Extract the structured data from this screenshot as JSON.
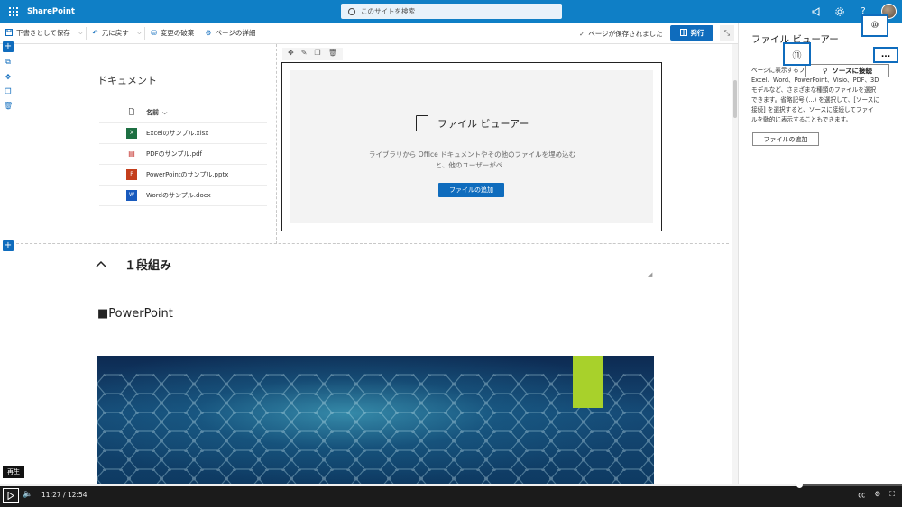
{
  "suitebar": {
    "app_name": "SharePoint",
    "search_placeholder": "このサイトを検索",
    "icons": [
      "megaphone-icon",
      "gear-icon",
      "help-icon",
      "avatar"
    ]
  },
  "commandbar": {
    "save_draft": "下書きとして保存",
    "undo": "元に戻す",
    "discard": "変更の破棄",
    "page_details": "ページの詳細",
    "saved_status": "ページが保存されました",
    "publish": "発行"
  },
  "documents": {
    "title": "ドキュメント",
    "column_name": "名前",
    "items": [
      {
        "name": "Excelのサンプル.xlsx",
        "icon": "excel-icon",
        "color": "#1d6f42"
      },
      {
        "name": "PDFのサンプル.pdf",
        "icon": "pdf-icon",
        "color": "#c4312b"
      },
      {
        "name": "PowerPointのサンプル.pptx",
        "icon": "powerpoint-icon",
        "color": "#c43e1c"
      },
      {
        "name": "Wordのサンプル.docx",
        "icon": "word-icon",
        "color": "#185abd"
      }
    ]
  },
  "file_viewer_placeholder": {
    "title": "ファイル ビューアー",
    "description_line1": "ライブラリから Office ドキュメントやその他のファイルを埋め込む",
    "description_line2": "と、他のユーザーがペ...",
    "add_button": "ファイルの追加"
  },
  "section2": {
    "heading": "１段組み",
    "powerpoint_heading": "■PowerPoint"
  },
  "property_pane": {
    "title": "ファイル ビューアー",
    "description_lines": [
      "ページに表示するファイ",
      "Excel、Word、PowerPoint、Visio、PDF、3D",
      "モデルなど、さまざまな種類のファイルを選択",
      "できます。省略記号 (...) を選択して、[ソースに",
      "接続] を選択すると、ソースに接続してファイ",
      "ルを動的に表示することもできます。"
    ],
    "add_button": "ファイルの追加",
    "source_button": "ソースに接続",
    "more_button": "..."
  },
  "callouts": {
    "ten": "⑩",
    "eleven": "⑪"
  },
  "video": {
    "tooltip": "再生",
    "current_time": "11:27",
    "separator": "/",
    "total_time": "12:54",
    "progress_fraction": 0.886
  },
  "colors": {
    "suitebar": "#0f7fc6",
    "accent": "#0f6cbd",
    "hero_bar": "#a8d12b"
  }
}
